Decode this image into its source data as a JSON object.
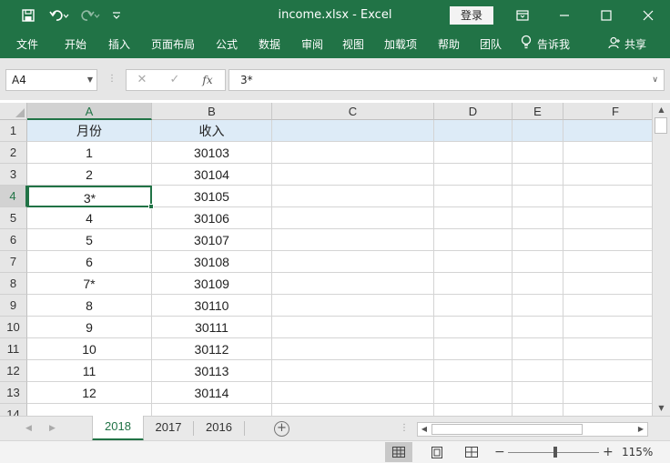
{
  "window": {
    "title": "income.xlsx  -  Excel",
    "login_label": "登录"
  },
  "ribbon": {
    "tabs": [
      "文件",
      "开始",
      "插入",
      "页面布局",
      "公式",
      "数据",
      "审阅",
      "视图",
      "加载项",
      "帮助",
      "团队",
      "告诉我",
      "共享"
    ]
  },
  "formula_bar": {
    "name_box": "A4",
    "fx_label": "fx",
    "value": "3*"
  },
  "columns": [
    "A",
    "B",
    "C",
    "D",
    "E",
    "F"
  ],
  "rows": [
    {
      "num": "1",
      "a": "月份",
      "b": "收入"
    },
    {
      "num": "2",
      "a": "1",
      "b": "30103"
    },
    {
      "num": "3",
      "a": "2",
      "b": "30104"
    },
    {
      "num": "4",
      "a": "3*",
      "b": "30105"
    },
    {
      "num": "5",
      "a": "4",
      "b": "30106"
    },
    {
      "num": "6",
      "a": "5",
      "b": "30107"
    },
    {
      "num": "7",
      "a": "6",
      "b": "30108"
    },
    {
      "num": "8",
      "a": "7*",
      "b": "30109"
    },
    {
      "num": "9",
      "a": "8",
      "b": "30110"
    },
    {
      "num": "10",
      "a": "9",
      "b": "30111"
    },
    {
      "num": "11",
      "a": "10",
      "b": "30112"
    },
    {
      "num": "12",
      "a": "11",
      "b": "30113"
    },
    {
      "num": "13",
      "a": "12",
      "b": "30114"
    },
    {
      "num": "14",
      "a": "",
      "b": ""
    }
  ],
  "sheets": [
    "2018",
    "2017",
    "2016"
  ],
  "active_sheet": "2018",
  "active_cell": "A4",
  "status": {
    "zoom": "115%"
  },
  "colors": {
    "accent": "#217346",
    "header_fill": "#ddebf7"
  }
}
